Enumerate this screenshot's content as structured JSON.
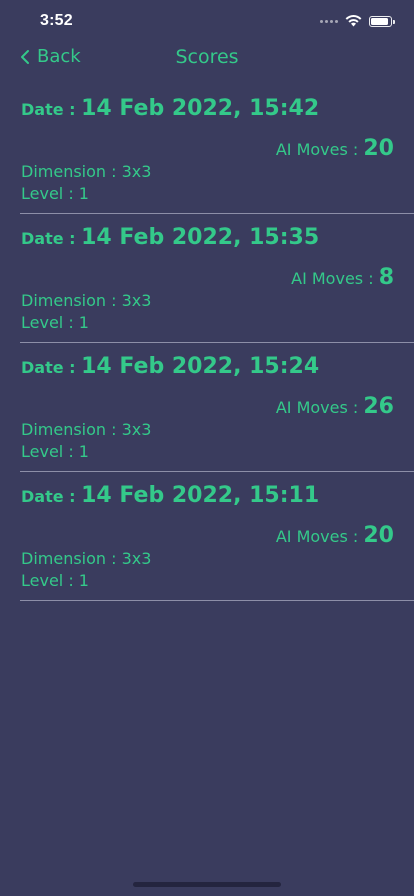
{
  "status_bar": {
    "time": "3:52",
    "battery_level": 0.9
  },
  "nav": {
    "back_label": "Back",
    "title": "Scores"
  },
  "labels": {
    "date": "Date : ",
    "ai_moves": "AI Moves : ",
    "dimension": "Dimension : ",
    "level": "Level : "
  },
  "scores": [
    {
      "date": "14 Feb 2022, 15:42",
      "ai_moves": "20",
      "dimension": "3x3",
      "level": "1"
    },
    {
      "date": "14 Feb 2022, 15:35",
      "ai_moves": "8",
      "dimension": "3x3",
      "level": "1"
    },
    {
      "date": "14 Feb 2022, 15:24",
      "ai_moves": "26",
      "dimension": "3x3",
      "level": "1"
    },
    {
      "date": "14 Feb 2022, 15:11",
      "ai_moves": "20",
      "dimension": "3x3",
      "level": "1"
    }
  ],
  "colors": {
    "background": "#3a3c5e",
    "accent": "#34c98a",
    "divider": "#c9cbe0"
  },
  "icons": {
    "back": "chevron-left-icon",
    "cellular": "cellular-signal-icon",
    "wifi": "wifi-icon",
    "battery": "battery-icon"
  }
}
